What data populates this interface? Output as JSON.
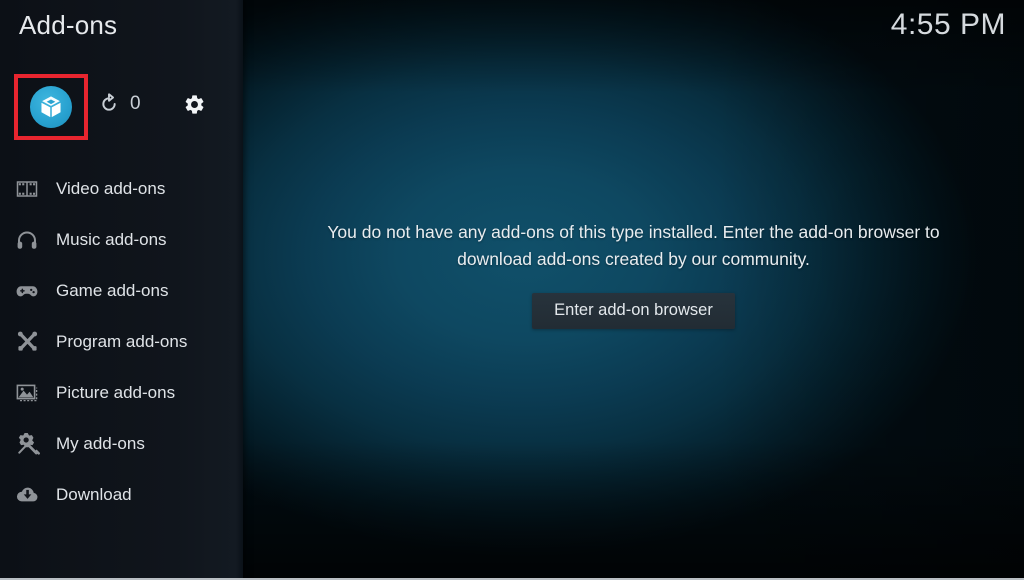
{
  "window": {
    "title": "Add-ons",
    "clock": "4:55 PM"
  },
  "colors": {
    "accent": "#29a3d1",
    "focus_highlight": "#e8252f",
    "background_center": "#10506a",
    "sidebar_background": "#10151c",
    "text_primary": "#e6e9ec",
    "button_background": "#27333c"
  },
  "toolbar": {
    "package_button": {
      "label": "Add-on browser",
      "icon": "package-icon"
    },
    "refresh_button": {
      "label": "Refresh",
      "icon": "refresh-icon",
      "count": "0"
    },
    "settings_button": {
      "label": "Settings",
      "icon": "gear-icon"
    }
  },
  "sidebar": {
    "items": [
      {
        "label": "Video add-ons",
        "icon": "film-icon"
      },
      {
        "label": "Music add-ons",
        "icon": "headphones-icon"
      },
      {
        "label": "Game add-ons",
        "icon": "gamepad-icon"
      },
      {
        "label": "Program add-ons",
        "icon": "tools-icon"
      },
      {
        "label": "Picture add-ons",
        "icon": "picture-icon"
      },
      {
        "label": "My add-ons",
        "icon": "gear-wrench-icon"
      },
      {
        "label": "Download",
        "icon": "download-icon"
      }
    ]
  },
  "main": {
    "empty_message": "You do not have any add-ons of this type installed. Enter the add-on browser to download add-ons created by our community.",
    "enter_browser_label": "Enter add-on browser"
  }
}
